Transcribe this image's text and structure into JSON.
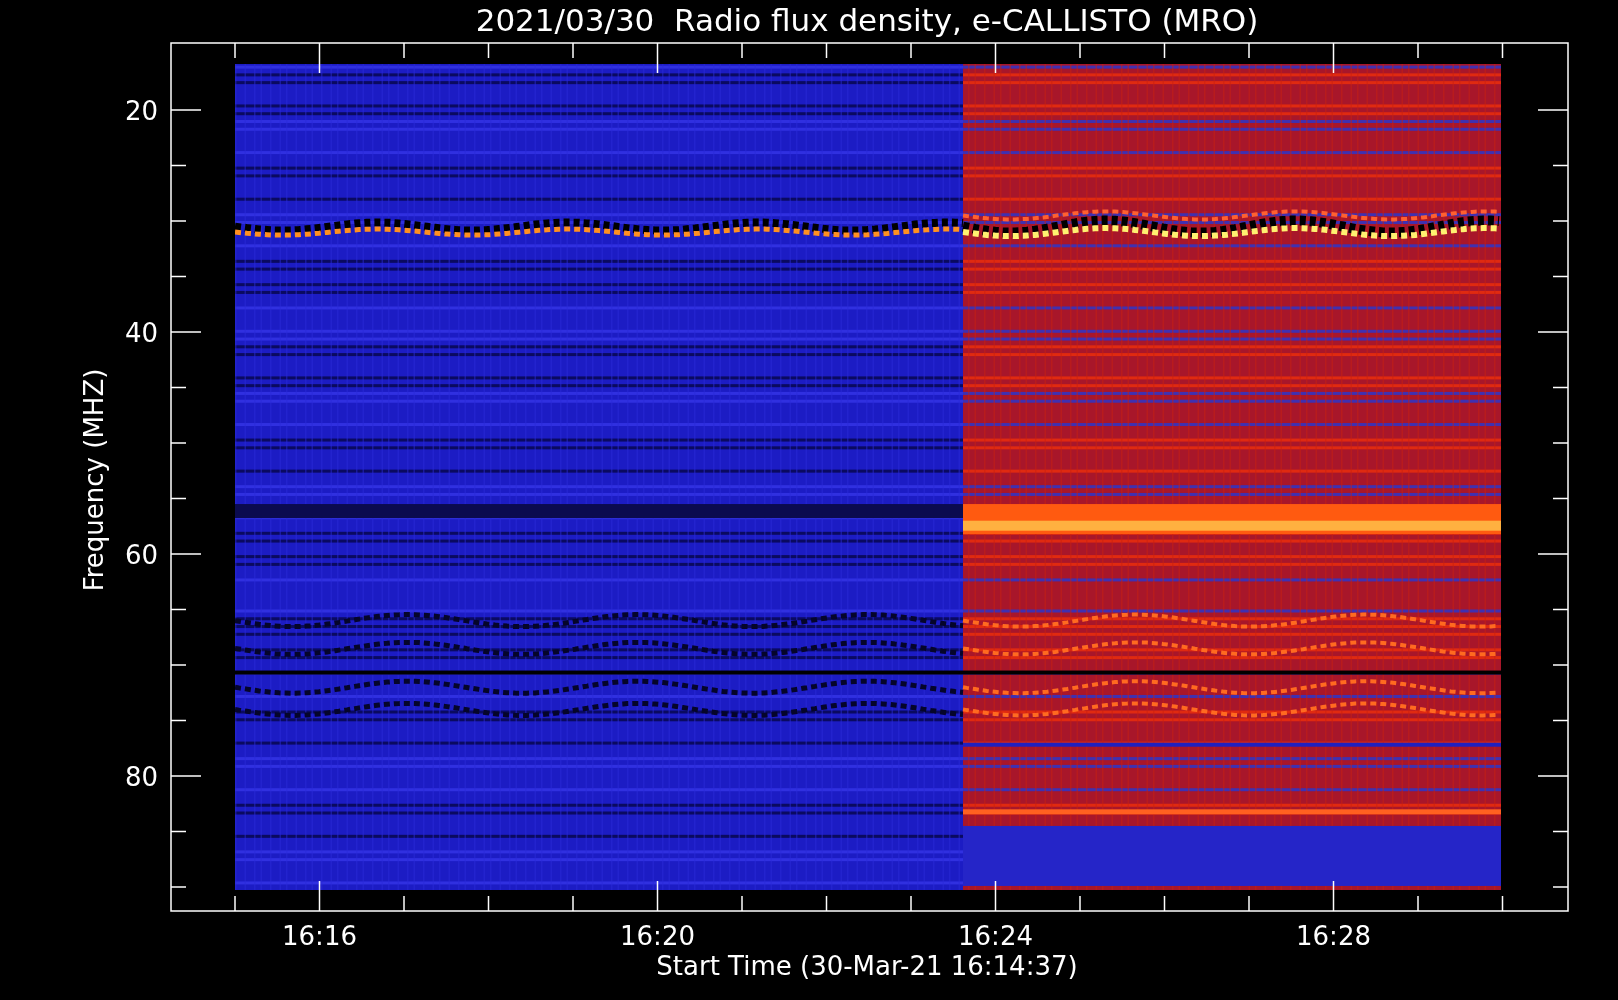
{
  "title": "2021/03/30  Radio flux density, e-CALLISTO (MRO)",
  "y_axis": {
    "label": "Frequency (MHZ)",
    "ticks": [
      "20",
      "40",
      "60",
      "80"
    ]
  },
  "x_axis": {
    "label": "Start Time (30-Mar-21 16:14:37)",
    "ticks": [
      "16:16",
      "16:20",
      "16:24",
      "16:28"
    ]
  }
}
